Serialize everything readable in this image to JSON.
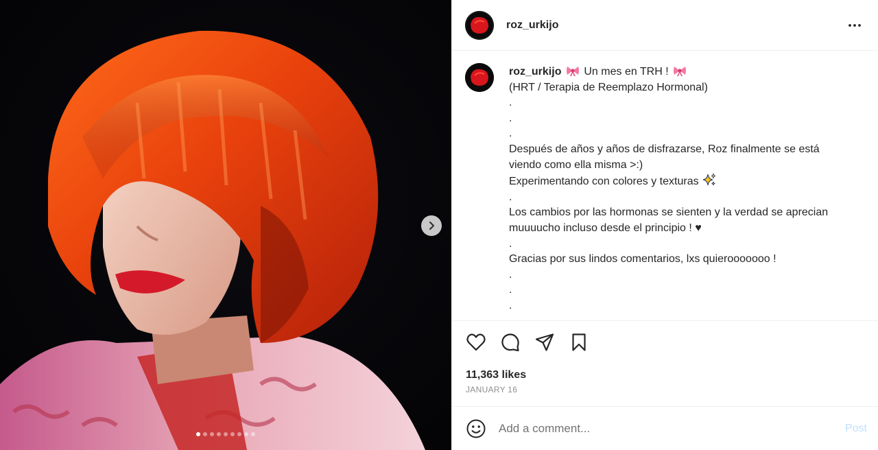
{
  "post": {
    "username": "roz_urkijo",
    "more_icon": "more-horizontal-icon",
    "media": {
      "slide_count": 9,
      "active_slide": 1,
      "next_icon": "chevron-right-icon"
    },
    "caption": {
      "username": "roz_urkijo",
      "title_text": " Un mes en TRH ! ",
      "title_icon": "ribbon-bow-emoji",
      "lines": [
        "(HRT / Terapia de Reemplazo Hormonal)",
        ".",
        ".",
        ".",
        "Después de años y años de disfrazarse, Roz finalmente se está",
        "viendo como ella misma >:)",
        "Experimentando con colores y texturas",
        ".",
        "Los cambios por las hormonas se sienten y la verdad se aprecian",
        "muuuucho incluso desde el principio ! ♥",
        ".",
        "Gracias por sus lindos comentarios, lxs quierooooooo !",
        ".",
        ".",
        "."
      ],
      "sparkle_icon": "sparkles-emoji"
    },
    "actions": {
      "like_icon": "heart-icon",
      "comment_icon": "comment-bubble-icon",
      "share_icon": "paper-plane-icon",
      "save_icon": "bookmark-icon"
    },
    "likes": "11,363 likes",
    "date": "JANUARY 16",
    "comment": {
      "emoji_icon": "smiley-icon",
      "placeholder": "Add a comment...",
      "post_label": "Post"
    }
  }
}
